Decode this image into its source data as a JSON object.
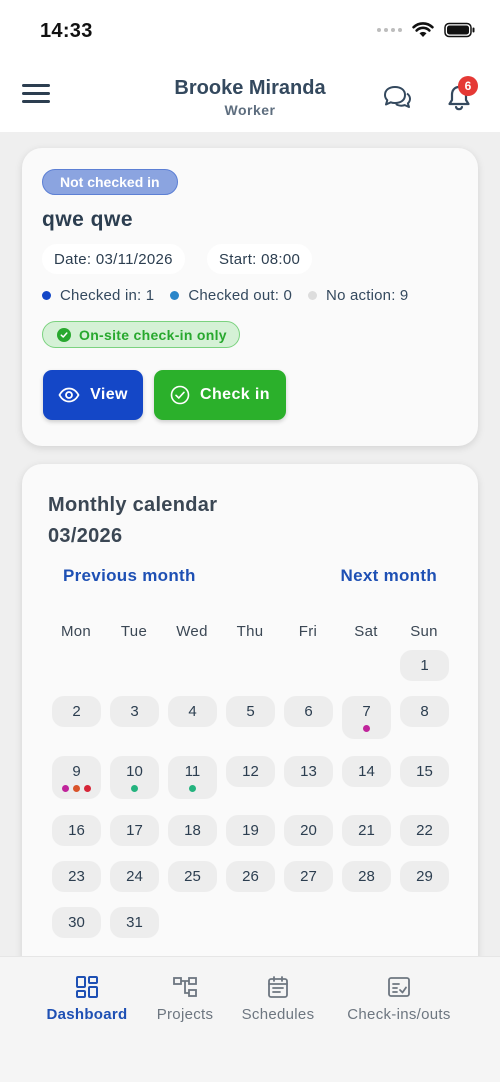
{
  "status_bar": {
    "time": "14:33"
  },
  "header": {
    "title": "Brooke Miranda",
    "subtitle": "Worker",
    "notification_count": "6"
  },
  "event_card": {
    "status": "Not checked in",
    "title": "qwe qwe",
    "date": "Date: 03/11/2026",
    "start": "Start: 08:00",
    "stats": [
      {
        "label": "Checked in: 1",
        "color": "#1447c7"
      },
      {
        "label": "Checked out: 0",
        "color": "#2b86c9"
      },
      {
        "label": "No action: 9",
        "color": "#dddddd"
      }
    ],
    "onsite_label": "On-site check-in only",
    "view_label": "View",
    "checkin_label": "Check in"
  },
  "calendar": {
    "title_line1": "Monthly calendar",
    "title_line2": "03/2026",
    "prev_label": "Previous month",
    "next_label": "Next month",
    "weekdays": [
      "Mon",
      "Tue",
      "Wed",
      "Thu",
      "Fri",
      "Sat",
      "Sun"
    ],
    "first_weekday_index": 6,
    "days_in_month": 31,
    "day_dots": {
      "7": [
        "#c0249b"
      ],
      "9": [
        "#c0249b",
        "#d9532a",
        "#d62638"
      ],
      "10": [
        "#24b37e"
      ],
      "11": [
        "#24b37e"
      ]
    }
  },
  "tabbar": {
    "tabs": [
      {
        "label": "Dashboard",
        "icon": "dashboard-icon",
        "active": true
      },
      {
        "label": "Projects",
        "icon": "projects-icon",
        "active": false
      },
      {
        "label": "Schedules",
        "icon": "schedules-icon",
        "active": false
      },
      {
        "label": "Check-ins/outs",
        "icon": "checkins-icon",
        "active": false
      }
    ]
  },
  "colors": {
    "primary": "#1447c7",
    "success": "#2bb02b",
    "link": "#1e50b4",
    "badge": "#e53935"
  }
}
